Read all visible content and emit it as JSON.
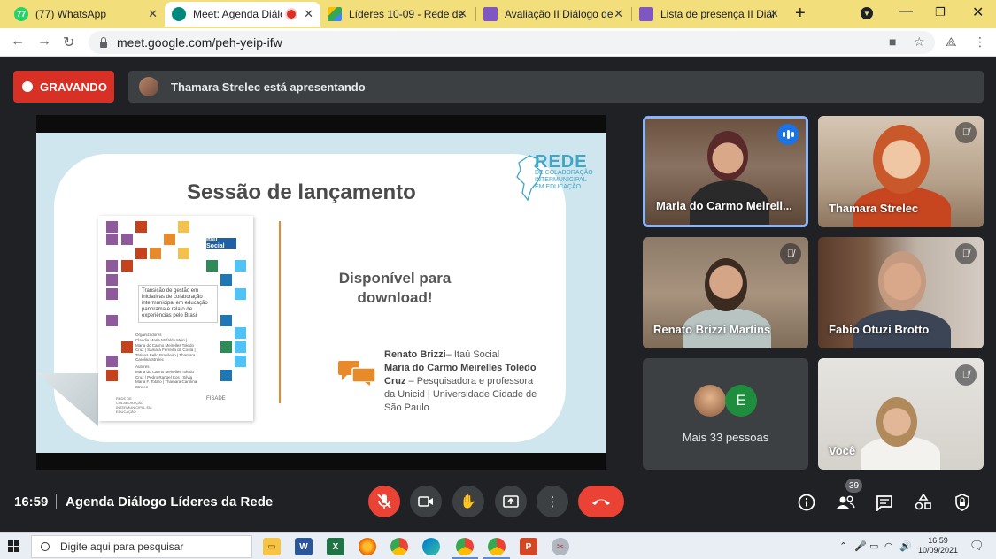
{
  "browser": {
    "tabs": [
      {
        "label": "(77) WhatsApp",
        "icon_text": "77",
        "icon_color": "#25d366"
      },
      {
        "label": "Meet: Agenda Diálogo",
        "icon_text": "",
        "icon_color": "#00897b"
      },
      {
        "label": "Líderes 10-09 - Rede de",
        "icon_text": "",
        "icon_color": "#34a853"
      },
      {
        "label": "Avaliação II Diálogo de",
        "icon_text": "",
        "icon_color": "#7e57c2"
      },
      {
        "label": "Lista de presença II Diál",
        "icon_text": "",
        "icon_color": "#7e57c2"
      }
    ],
    "url": "meet.google.com/peh-yeip-ifw"
  },
  "meet": {
    "recording_label": "GRAVANDO",
    "presenting_text": "Thamara Strelec está apresentando",
    "slide": {
      "title": "Sessão de lançamento",
      "logo_name": "REDE",
      "logo_sub": "DE COLABORAÇÃO INTERMUNICIPAL EM EDUCAÇÃO",
      "download_text": "Disponível para download!",
      "book_brand": "Itaú Social",
      "book_title": "Transição de gestão em iniciativas de colaboração intermunicipal em educação panorama e relato de experiências pelo Brasil",
      "book_org_label": "Organizadores",
      "book_org_names": "Claudia Maria Mafalda Melo | Maria do Carmo Meirelles Toledo Cruz | Samara Ferreira da Costa | Tatiana Bello Brasileiro | Thamara Carolina Strelec",
      "book_author_label": "Autores",
      "book_author_names": "Maria do Carmo Meirelles Toledo Cruz | Pedro Rangel Kos | Silvia Maria F. Totaro | Thamara Carolina Strelec",
      "book_footer_left": "REDE DE COLABORAÇÃO INTERMUNICIPAL EM EDUCAÇÃO",
      "book_footer_right": "FISADE",
      "speaker1_name": "Renato Brizzi",
      "speaker1_org": "– Itaú Social",
      "speaker2_name": "Maria do Carmo Meirelles Toledo Cruz",
      "speaker2_desc": "– Pesquisadora e professora da Unicid | Universidade Cidade de São Paulo"
    },
    "participants": [
      {
        "name": "Maria do Carmo Meirell...",
        "speaking": true
      },
      {
        "name": "Thamara Strelec",
        "speaking": false
      },
      {
        "name": "Renato Brizzi Martins",
        "speaking": false
      },
      {
        "name": "Fabio Otuzi Brotto",
        "speaking": false
      },
      {
        "name": "Você",
        "speaking": false
      }
    ],
    "more_people": {
      "label": "Mais 33 pessoas",
      "avatar_letter": "E"
    },
    "clock": "16:59",
    "meeting_title": "Agenda Diálogo Líderes da Rede",
    "participant_count": "39"
  },
  "taskbar": {
    "search_placeholder": "Digite aqui para pesquisar",
    "time": "16:59",
    "date": "10/09/2021"
  },
  "colors": {
    "recording": "#d93025",
    "end_call": "#ea4335",
    "speaking_border": "#8ab4f8",
    "slide_bg": "#cfe6ee",
    "accent_orange": "#e98a2a"
  }
}
